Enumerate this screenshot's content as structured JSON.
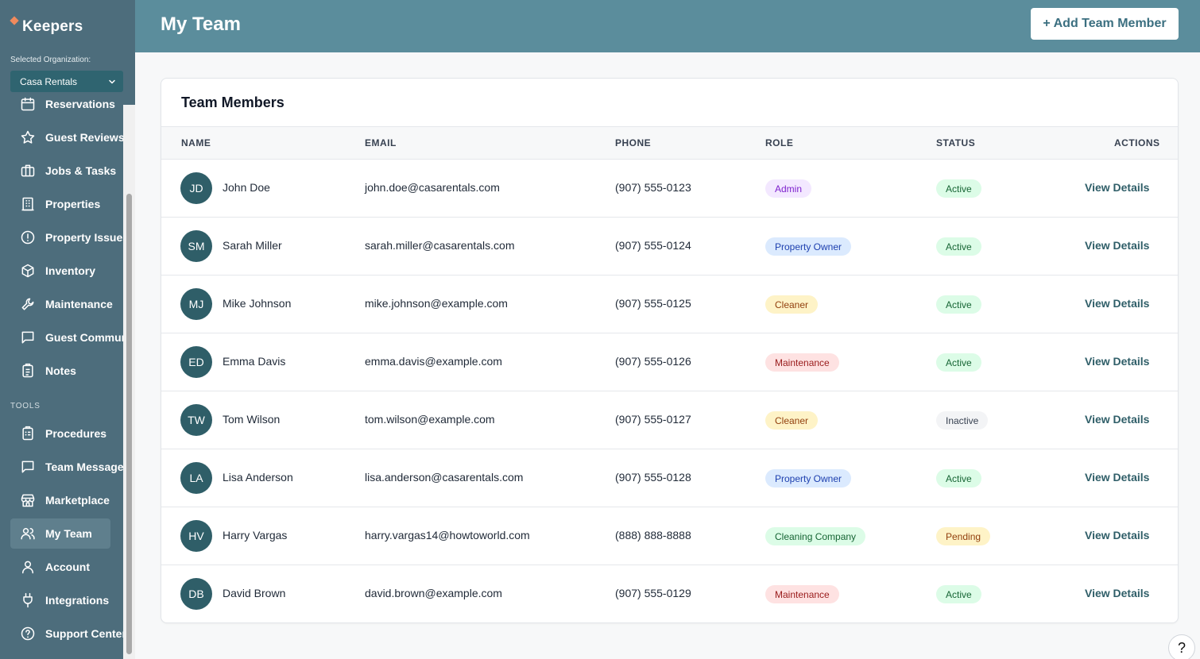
{
  "sidebar": {
    "brand": "Keepers",
    "org_label": "Selected Organization:",
    "org_selected": "Casa Rentals",
    "items": [
      {
        "label": "Reservations",
        "icon": "calendar-icon"
      },
      {
        "label": "Guest Reviews",
        "icon": "star-icon"
      },
      {
        "label": "Jobs & Tasks",
        "icon": "briefcase-icon"
      },
      {
        "label": "Properties",
        "icon": "building-icon"
      },
      {
        "label": "Property Issues",
        "icon": "alert-circle-icon"
      },
      {
        "label": "Inventory",
        "icon": "box-icon"
      },
      {
        "label": "Maintenance",
        "icon": "wrench-icon"
      },
      {
        "label": "Guest Communication",
        "icon": "chat-icon"
      },
      {
        "label": "Notes",
        "icon": "clipboard-icon"
      }
    ],
    "tools_label": "TOOLS",
    "tools": [
      {
        "label": "Procedures",
        "icon": "clipboard-list-icon"
      },
      {
        "label": "Team Messages",
        "icon": "message-icon"
      },
      {
        "label": "Marketplace",
        "icon": "store-icon"
      },
      {
        "label": "My Team",
        "icon": "users-icon",
        "active": true
      },
      {
        "label": "Account",
        "icon": "user-icon"
      },
      {
        "label": "Integrations",
        "icon": "plug-icon"
      },
      {
        "label": "Support Center",
        "icon": "help-circle-icon"
      }
    ]
  },
  "header": {
    "title": "My Team",
    "add_button": "+ Add Team Member"
  },
  "card": {
    "title": "Team Members",
    "columns": [
      "NAME",
      "EMAIL",
      "PHONE",
      "ROLE",
      "STATUS",
      "ACTIONS"
    ],
    "action_label": "View Details",
    "rows": [
      {
        "initials": "JD",
        "name": "John Doe",
        "email": "john.doe@casarentals.com",
        "phone": "(907) 555-0123",
        "role": "Admin",
        "status": "Active"
      },
      {
        "initials": "SM",
        "name": "Sarah Miller",
        "email": "sarah.miller@casarentals.com",
        "phone": "(907) 555-0124",
        "role": "Property Owner",
        "status": "Active"
      },
      {
        "initials": "MJ",
        "name": "Mike Johnson",
        "email": "mike.johnson@example.com",
        "phone": "(907) 555-0125",
        "role": "Cleaner",
        "status": "Active"
      },
      {
        "initials": "ED",
        "name": "Emma Davis",
        "email": "emma.davis@example.com",
        "phone": "(907) 555-0126",
        "role": "Maintenance",
        "status": "Active"
      },
      {
        "initials": "TW",
        "name": "Tom Wilson",
        "email": "tom.wilson@example.com",
        "phone": "(907) 555-0127",
        "role": "Cleaner",
        "status": "Inactive"
      },
      {
        "initials": "LA",
        "name": "Lisa Anderson",
        "email": "lisa.anderson@casarentals.com",
        "phone": "(907) 555-0128",
        "role": "Property Owner",
        "status": "Active"
      },
      {
        "initials": "HV",
        "name": "Harry Vargas",
        "email": "harry.vargas14@howtoworld.com",
        "phone": "(888) 888-8888",
        "role": "Cleaning Company",
        "status": "Pending"
      },
      {
        "initials": "DB",
        "name": "David Brown",
        "email": "david.brown@example.com",
        "phone": "(907) 555-0129",
        "role": "Maintenance",
        "status": "Active"
      }
    ]
  },
  "colors": {
    "sidebar_bg": "#4d6d7c",
    "header_bg": "#5b8d9c",
    "avatar_bg": "#2f5e68",
    "role_colors": {
      "Admin": {
        "bg": "#f3e8ff",
        "fg": "#7e22ce"
      },
      "Property Owner": {
        "bg": "#dbeafe",
        "fg": "#1e40af"
      },
      "Cleaner": {
        "bg": "#fef3c7",
        "fg": "#92400e"
      },
      "Maintenance": {
        "bg": "#fee2e2",
        "fg": "#991b1b"
      },
      "Cleaning Company": {
        "bg": "#dcfce7",
        "fg": "#166534"
      }
    },
    "status_colors": {
      "Active": {
        "bg": "#dcfce7",
        "fg": "#166534"
      },
      "Inactive": {
        "bg": "#f3f4f6",
        "fg": "#374151"
      },
      "Pending": {
        "bg": "#fef3c7",
        "fg": "#92400e"
      }
    }
  },
  "help_label": "?"
}
